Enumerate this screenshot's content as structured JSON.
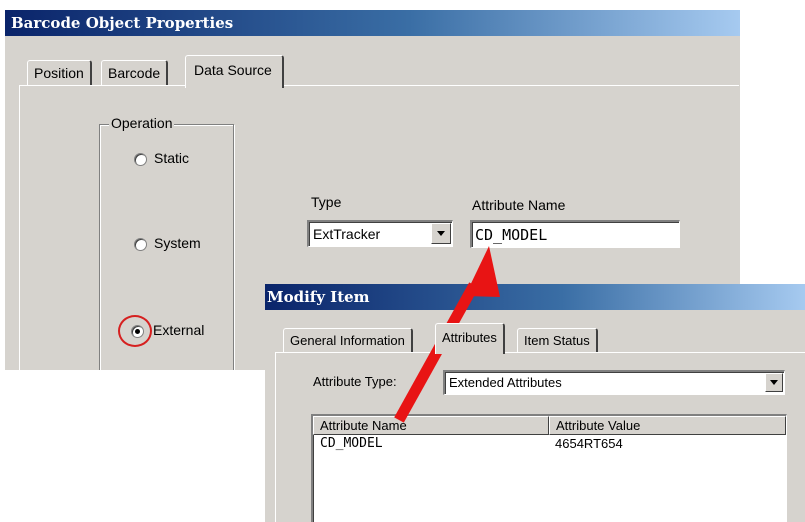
{
  "barcode_window": {
    "title": "Barcode Object Properties",
    "tabs": [
      "Position",
      "Barcode",
      "Data Source"
    ],
    "active_tab": "Data Source",
    "operation": {
      "group_label": "Operation",
      "options": [
        "Static",
        "System",
        "External"
      ],
      "selected": "External"
    },
    "type": {
      "label": "Type",
      "value": "ExtTracker"
    },
    "attribute_name": {
      "label": "Attribute Name",
      "value": "CD_MODEL"
    }
  },
  "modify_window": {
    "title": "Modify Item",
    "tabs": [
      "General Information",
      "Attributes",
      "Item Status"
    ],
    "active_tab": "Attributes",
    "attribute_type": {
      "label": "Attribute Type:",
      "value": "Extended Attributes"
    },
    "table": {
      "columns": [
        "Attribute Name",
        "Attribute Value"
      ],
      "rows": [
        [
          "CD_MODEL",
          "4654RT654"
        ]
      ]
    }
  },
  "colors": {
    "titlebar": "#0a246a",
    "window_face": "#d6d3ce",
    "highlight_circle": "#d62020",
    "arrow": "#e81414"
  }
}
